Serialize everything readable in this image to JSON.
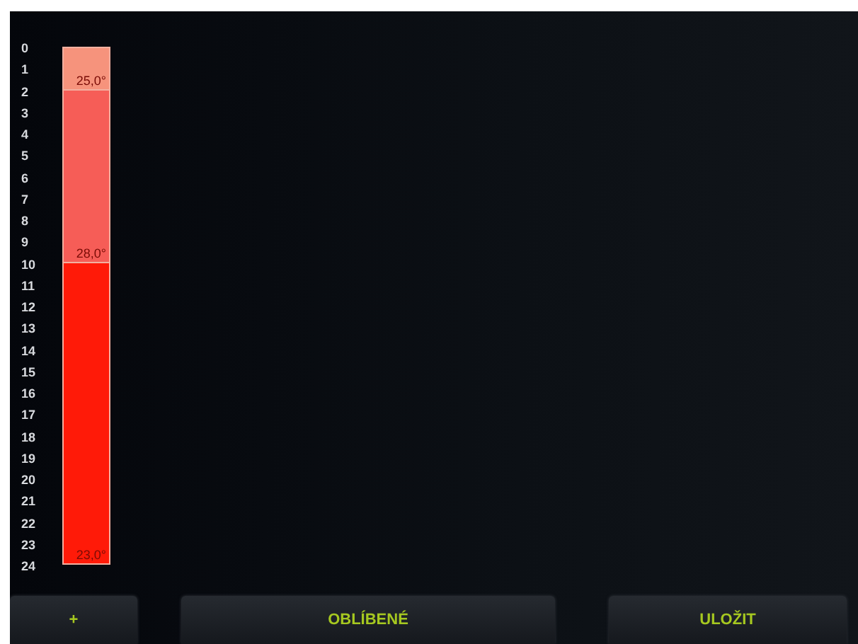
{
  "segments": [
    {
      "hours": [
        "0",
        "1"
      ],
      "temperature": "25,0°",
      "color": "#f6937c"
    },
    {
      "hours": [
        "2",
        "3",
        "4",
        "5",
        "6",
        "7",
        "8",
        "9"
      ],
      "temperature": "28,0°",
      "color": "#f65d57"
    },
    {
      "hours": [
        "10",
        "11",
        "12",
        "13",
        "14",
        "15",
        "16",
        "17",
        "18",
        "19",
        "20",
        "21",
        "22",
        "23"
      ],
      "temperature": "23,0°",
      "color": "#ff1a08"
    }
  ],
  "end_hour": "24",
  "buttons": [
    "+",
    "OBLÍBENÉ",
    "ULOŽIT"
  ]
}
